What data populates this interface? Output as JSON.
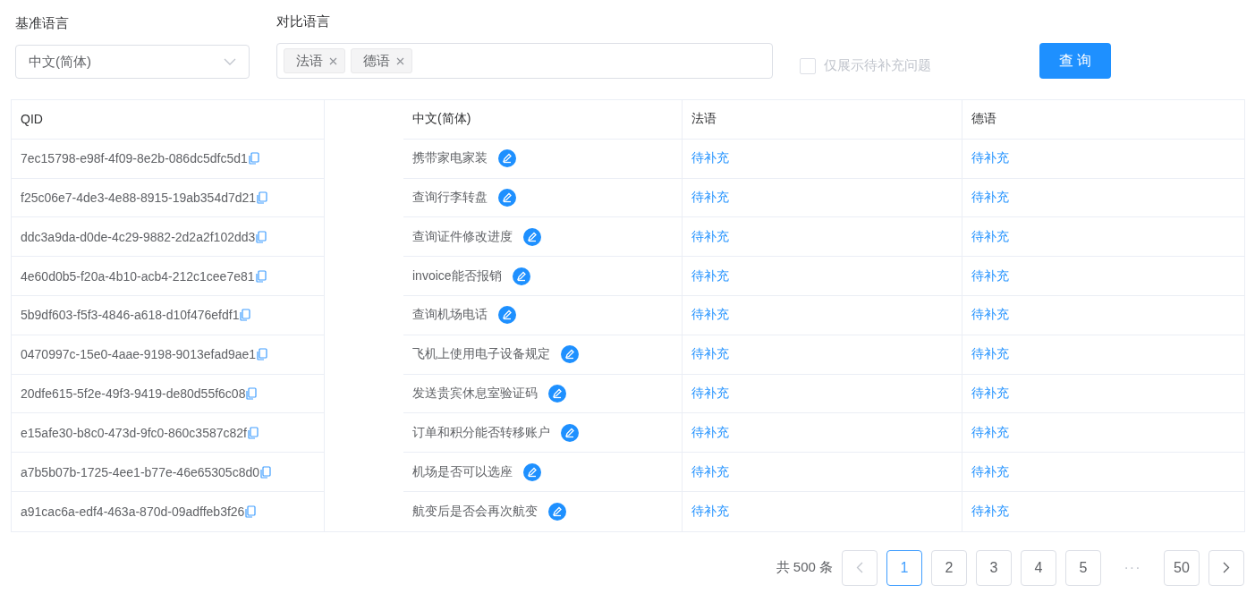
{
  "filters": {
    "base_language": {
      "label": "基准语言",
      "value": "中文(简体)"
    },
    "compare_languages": {
      "label": "对比语言",
      "tags": [
        "法语",
        "德语"
      ]
    },
    "only_pending": {
      "label": "仅展示待补充问题",
      "checked": false
    },
    "query_button": "查 询"
  },
  "table": {
    "columns": [
      "QID",
      "中文(简体)",
      "法语",
      "德语"
    ],
    "rows": [
      {
        "qid": "7ec15798-e98f-4f09-8e2b-086dc5dfc5d1",
        "zh": "携带家电家装",
        "fr": "待补充",
        "de": "待补充"
      },
      {
        "qid": "f25c06e7-4de3-4e88-8915-19ab354d7d21",
        "zh": "查询行李转盘",
        "fr": "待补充",
        "de": "待补充"
      },
      {
        "qid": "ddc3a9da-d0de-4c29-9882-2d2a2f102dd3",
        "zh": "查询证件修改进度",
        "fr": "待补充",
        "de": "待补充"
      },
      {
        "qid": "4e60d0b5-f20a-4b10-acb4-212c1cee7e81",
        "zh": "invoice能否报销",
        "fr": "待补充",
        "de": "待补充"
      },
      {
        "qid": "5b9df603-f5f3-4846-a618-d10f476efdf1",
        "zh": "查询机场电话",
        "fr": "待补充",
        "de": "待补充"
      },
      {
        "qid": "0470997c-15e0-4aae-9198-9013efad9ae1",
        "zh": "飞机上使用电子设备规定",
        "fr": "待补充",
        "de": "待补充"
      },
      {
        "qid": "20dfe615-5f2e-49f3-9419-de80d55f6c08",
        "zh": "发送贵宾休息室验证码",
        "fr": "待补充",
        "de": "待补充"
      },
      {
        "qid": "e15afe30-b8c0-473d-9fc0-860c3587c82f",
        "zh": "订单和积分能否转移账户",
        "fr": "待补充",
        "de": "待补充"
      },
      {
        "qid": "a7b5b07b-1725-4ee1-b77e-46e65305c8d0",
        "zh": "机场是否可以选座",
        "fr": "待补充",
        "de": "待补充"
      },
      {
        "qid": "a91cac6a-edf4-463a-870d-09adffeb3f26",
        "zh": "航变后是否会再次航变",
        "fr": "待补充",
        "de": "待补充"
      }
    ]
  },
  "pagination": {
    "total": "共 500 条",
    "prev_disabled": true,
    "pages": [
      {
        "label": "1",
        "selected": true
      },
      {
        "label": "2",
        "selected": false
      },
      {
        "label": "3",
        "selected": false
      },
      {
        "label": "4",
        "selected": false
      },
      {
        "label": "5",
        "selected": false
      },
      {
        "label": "···",
        "kind": "ellipsis",
        "selected": false
      },
      {
        "label": "50",
        "selected": false
      }
    ]
  }
}
